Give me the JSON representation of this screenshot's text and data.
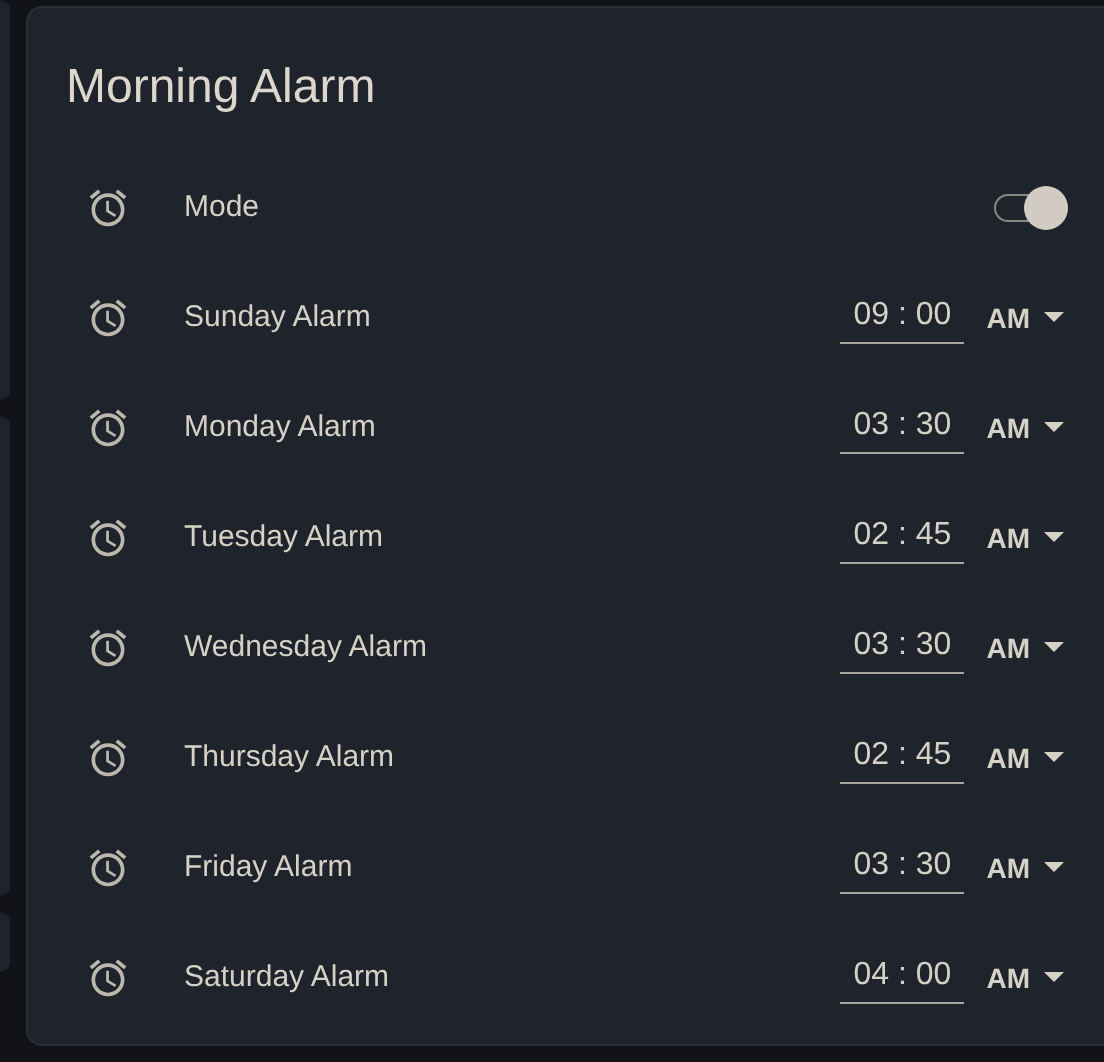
{
  "card": {
    "title": "Morning Alarm"
  },
  "rows": [
    {
      "kind": "toggle",
      "label": "Mode",
      "on": true
    },
    {
      "kind": "time",
      "label": "Sunday Alarm",
      "time": "09 : 00",
      "period": "AM"
    },
    {
      "kind": "time",
      "label": "Monday Alarm",
      "time": "03 : 30",
      "period": "AM"
    },
    {
      "kind": "time",
      "label": "Tuesday Alarm",
      "time": "02 : 45",
      "period": "AM"
    },
    {
      "kind": "time",
      "label": "Wednesday Alarm",
      "time": "03 : 30",
      "period": "AM"
    },
    {
      "kind": "time",
      "label": "Thursday Alarm",
      "time": "02 : 45",
      "period": "AM"
    },
    {
      "kind": "time",
      "label": "Friday Alarm",
      "time": "03 : 30",
      "period": "AM"
    },
    {
      "kind": "time",
      "label": "Saturday Alarm",
      "time": "04 : 00",
      "period": "AM"
    }
  ]
}
